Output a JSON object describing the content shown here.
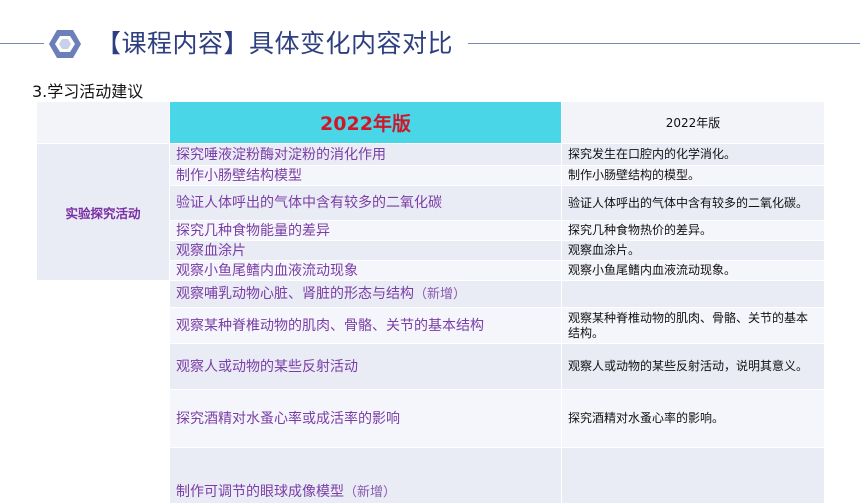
{
  "header": {
    "title": "【课程内容】具体变化内容对比",
    "accent_color": "#2e3f7f"
  },
  "section": {
    "heading": "3.学习活动建议"
  },
  "table": {
    "col_new_header": "2022年版",
    "col_old_header": "2022年版",
    "category": "实验探究活动",
    "rows": [
      {
        "new": "探究唾液淀粉酶对淀粉的消化作用",
        "old": "探究发生在口腔内的化学消化。"
      },
      {
        "new": "制作小肠壁结构模型",
        "old": "制作小肠壁结构的模型。"
      },
      {
        "new": "验证人体呼出的气体中含有较多的二氧化碳",
        "old": "验证人体呼出的气体中含有较多的二氧化碳。"
      },
      {
        "new": "探究几种食物能量的差异",
        "old": "探究几种食物热价的差异。"
      },
      {
        "new": "观察血涂片",
        "old": "观察血涂片。"
      },
      {
        "new": "观察小鱼尾鳍内血液流动现象",
        "old": "观察小鱼尾鳍内血液流动现象。"
      },
      {
        "new": "观察哺乳动物心脏、肾脏的形态与结构",
        "note": "（新增）",
        "old": ""
      },
      {
        "new": "观察某种脊椎动物的肌肉、骨骼、关节的基本结构",
        "old": "观察某种脊椎动物的肌肉、骨骼、关节的基本结构。"
      },
      {
        "new": "观察人或动物的某些反射活动",
        "old": "观察人或动物的某些反射活动，说明其意义。"
      },
      {
        "new": "探究酒精对水蚤心率或成活率的影响",
        "old": "探究酒精对水蚤心率的影响。"
      },
      {
        "new": "制作可调节的眼球成像模型",
        "note": "（新增）",
        "old": ""
      }
    ]
  }
}
